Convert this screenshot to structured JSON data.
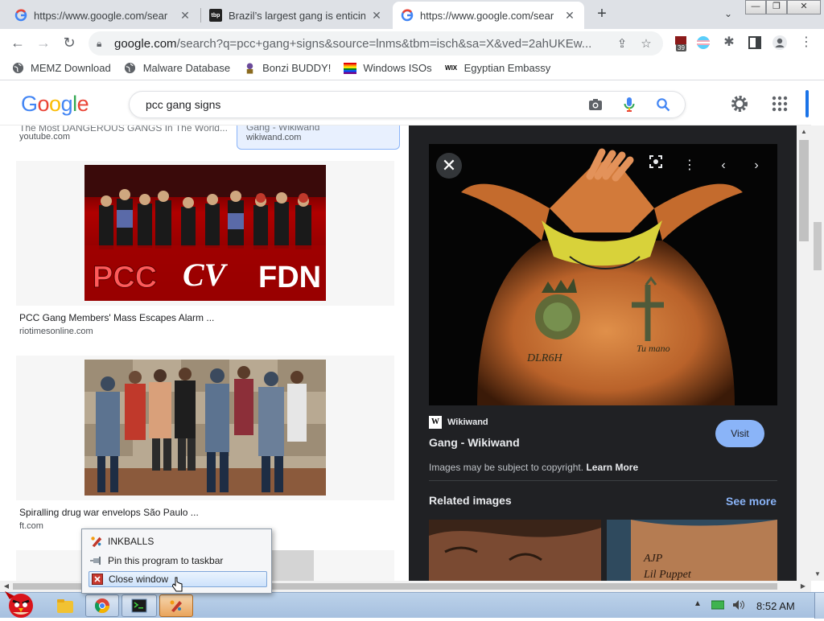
{
  "browser": {
    "tabs": [
      {
        "title": "https://www.google.com/sear",
        "icon": "google-icon",
        "active": false
      },
      {
        "title": "Brazil’s largest gang is enticin",
        "icon": "tbp-icon",
        "active": false
      },
      {
        "title": "https://www.google.com/sear",
        "icon": "google-icon",
        "active": true
      }
    ],
    "tab2_favicon_text": "tbp",
    "new_tab_label": "+",
    "window_controls": {
      "minimize": "—",
      "restore": "❐",
      "close": "✕"
    },
    "url_host": "google.com",
    "url_rest": "/search?q=pcc+gang+signs&source=lnms&tbm=isch&sa=X&ved=2ahUKEw...",
    "extension_badge": "39",
    "bookmarks": [
      {
        "label": "MEMZ Download",
        "icon": "globe-icon"
      },
      {
        "label": "Malware Database",
        "icon": "globe-icon"
      },
      {
        "label": "Bonzi BUDDY!",
        "icon": "bonzi-icon"
      },
      {
        "label": "Windows ISOs",
        "icon": "rainbow-flag-icon"
      },
      {
        "label": "Egyptian Embassy",
        "icon": "wix-icon"
      }
    ],
    "wix_icon_text": "WIX"
  },
  "google": {
    "logo": "Google",
    "search_query": "pcc gang signs",
    "logo_colors": [
      "#4285f4",
      "#ea4335",
      "#fbbc05",
      "#4285f4",
      "#34a853",
      "#ea4335"
    ]
  },
  "results": [
    {
      "title": "The Most DANGEROUS GANGS In The World...",
      "source": "youtube.com"
    },
    {
      "title": "Gang - Wikiwand",
      "source": "wikiwand.com"
    },
    {
      "title": "PCC Gang Members' Mass Escapes Alarm ...",
      "source": "riotimesonline.com",
      "image_text": [
        "PCC",
        "CV",
        "FDN"
      ]
    },
    {
      "title": "Spiralling drug war envelops São Paulo ...",
      "source": "ft.com"
    }
  ],
  "preview": {
    "close_label": "✕",
    "site_badge": "W",
    "site": "Wikiwand",
    "title": "Gang - Wikiwand",
    "visit_label": "Visit",
    "copyright_text": "Images may be subject to copyright.",
    "learn_more": "Learn More",
    "related_heading": "Related images",
    "see_more": "See more"
  },
  "jumplist": {
    "items": [
      {
        "label": "INKBALLS",
        "icon": "inkballs-icon"
      },
      {
        "label": "Pin this program to taskbar",
        "icon": "pin-icon"
      },
      {
        "label": "Close window",
        "icon": "close-window-icon",
        "highlighted": true
      }
    ]
  },
  "taskbar": {
    "clock": "8:52 AM"
  },
  "colors": {
    "accent": "#1a73e8",
    "preview_bg": "#202124",
    "visit_button": "#8ab4f8",
    "see_more": "#8ab4f8"
  }
}
